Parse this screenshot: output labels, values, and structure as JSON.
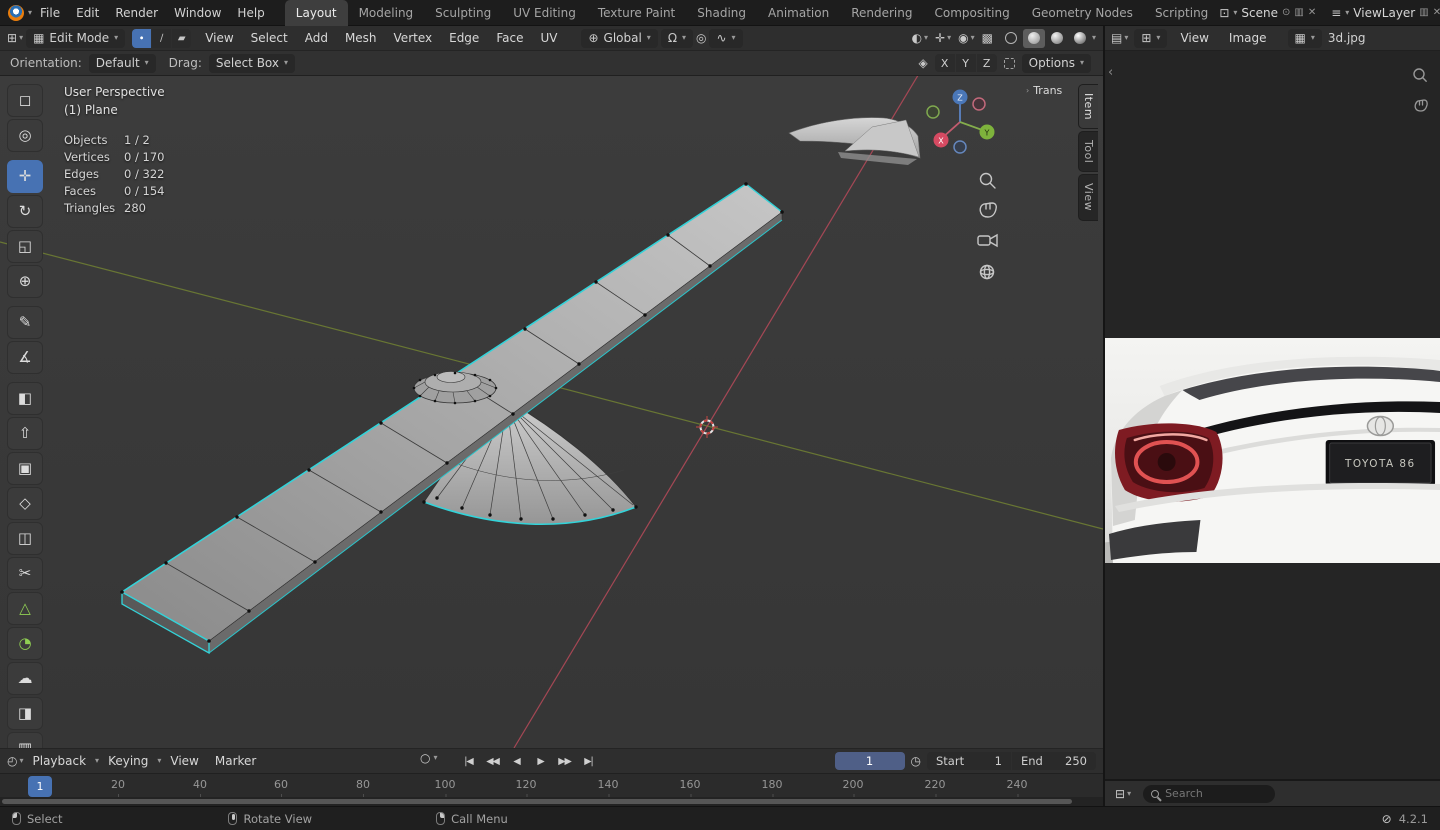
{
  "colors": {
    "accent_blue": "#4772b3",
    "selection_cyan": "#33d3d9",
    "axis_x_red": "#b84a5a",
    "axis_y_green": "#7a8b3a",
    "header_bg": "#2e2e2e",
    "viewport_bg": "#3c3c3c"
  },
  "icons": {
    "chevron_down": "▾",
    "chevron_right": "›",
    "chevron_left": "‹",
    "editor_3d_viewport": "⊞",
    "editor_image": "▤",
    "editor_timeline": "◴",
    "editor_properties": "⊟",
    "edit_mode_cube": "▦",
    "vertex_select": "∙",
    "edge_select": "∕",
    "face_select": "▰",
    "orientation_globe": "⊕",
    "snap_magnet": "Ω",
    "proportional_circle": "◎",
    "proportional_falloff": "∿",
    "visibility_filter": "◐",
    "gizmo_cross": "✛",
    "overlays": "◉",
    "xray": "▩",
    "mirror": "◈",
    "autokey_record": "○",
    "clock": "◷",
    "scene_block": "⊡",
    "viewlayer_stack": "≡",
    "image_datablock": "▦",
    "pin": "⊙",
    "duplicate": "▥",
    "close": "✕",
    "offline": "⊘"
  },
  "topbar": {
    "menus": [
      "File",
      "Edit",
      "Render",
      "Window",
      "Help"
    ],
    "workspaces": [
      "Layout",
      "Modeling",
      "Sculpting",
      "UV Editing",
      "Texture Paint",
      "Shading",
      "Animation",
      "Rendering",
      "Compositing",
      "Geometry Nodes",
      "Scripting"
    ],
    "active_workspace": "Layout",
    "scene_name": "Scene",
    "viewlayer_name": "ViewLayer"
  },
  "viewport_header": {
    "mode_label": "Edit Mode",
    "menus": [
      "View",
      "Select",
      "Add",
      "Mesh",
      "Vertex",
      "Edge",
      "Face",
      "UV"
    ],
    "orientation_value": "Global"
  },
  "tool_settings": {
    "orientation_label": "Orientation:",
    "orientation_value": "Default",
    "drag_label": "Drag:",
    "drag_value": "Select Box",
    "axes": [
      "X",
      "Y",
      "Z"
    ],
    "options_label": "Options"
  },
  "tools": [
    {
      "name": "select-box",
      "glyph": "◻"
    },
    {
      "name": "cursor",
      "glyph": "◎"
    },
    {
      "name": "move",
      "glyph": "✛",
      "active": true
    },
    {
      "name": "rotate",
      "glyph": "↻"
    },
    {
      "name": "scale",
      "glyph": "◱"
    },
    {
      "name": "transform",
      "glyph": "⊕"
    },
    {
      "name": "annotate",
      "glyph": "✎"
    },
    {
      "name": "measure",
      "glyph": "∡"
    },
    {
      "name": "add-cube",
      "glyph": "◧"
    },
    {
      "name": "extrude-region",
      "glyph": "⇧"
    },
    {
      "name": "inset-faces",
      "glyph": "▣"
    },
    {
      "name": "bevel",
      "glyph": "◇"
    },
    {
      "name": "loop-cut",
      "glyph": "◫"
    },
    {
      "name": "knife",
      "glyph": "✂"
    },
    {
      "name": "poly-build",
      "glyph": "△"
    },
    {
      "name": "spin",
      "glyph": "◔"
    },
    {
      "name": "smooth",
      "glyph": "☁"
    },
    {
      "name": "edge-slide",
      "glyph": "◨"
    },
    {
      "name": "rip-region",
      "glyph": "▥"
    }
  ],
  "viewport": {
    "perspective_label": "User Perspective",
    "object_label": "(1) Plane",
    "stats": [
      {
        "label": "Objects",
        "value": "1 / 2"
      },
      {
        "label": "Vertices",
        "value": "0 / 170"
      },
      {
        "label": "Edges",
        "value": "0 / 322"
      },
      {
        "label": "Faces",
        "value": "0 / 154"
      },
      {
        "label": "Triangles",
        "value": "280"
      }
    ],
    "sidebar_tabs": [
      "Item",
      "Tool",
      "View"
    ],
    "panel_peek_label": "Trans",
    "gizmo_axes": {
      "x": "X",
      "y": "Y",
      "z": "Z"
    }
  },
  "image_editor": {
    "menus": [
      "View",
      "Image"
    ],
    "image_name": "3d.jpg",
    "car_plate_text": "TOYOTA 86"
  },
  "timeline": {
    "menus": [
      "Playback",
      "Keying",
      "View",
      "Marker"
    ],
    "playback_buttons": [
      "|◀",
      "◀◀",
      "◀",
      "▶",
      "▶▶",
      "▶|"
    ],
    "current_frame": "1",
    "playhead_label": "1",
    "start_label": "Start",
    "start_value": "1",
    "end_label": "End",
    "end_value": "250",
    "ruler_ticks": [
      "20",
      "40",
      "60",
      "80",
      "100",
      "120",
      "140",
      "160",
      "180",
      "200",
      "220",
      "240"
    ]
  },
  "properties_editor": {
    "search_placeholder": "Search"
  },
  "statusbar": {
    "items": [
      "Select",
      "Rotate View",
      "Call Menu"
    ],
    "version": "4.2.1"
  }
}
